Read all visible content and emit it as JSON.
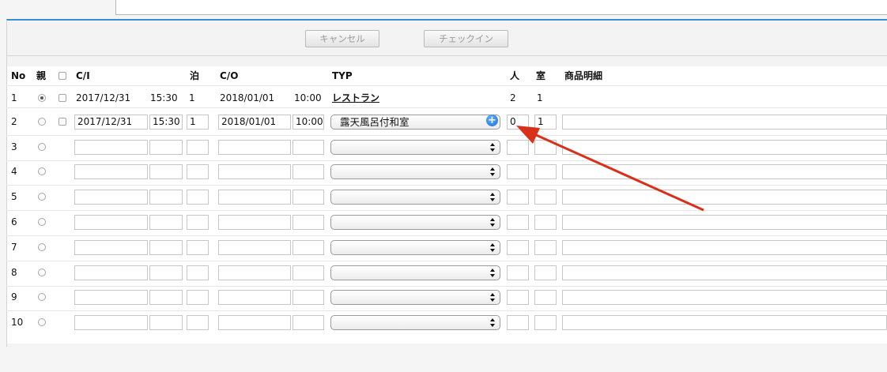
{
  "buttons": {
    "cancel": "キャンセル",
    "checkin": "チェックイン"
  },
  "headers": {
    "no": "No",
    "parent": "親",
    "ci": "C/I",
    "nights": "泊",
    "co": "C/O",
    "typ": "TYP",
    "persons": "人",
    "rooms": "室",
    "details": "商品明細"
  },
  "rows": [
    {
      "no": "1",
      "parent_selected": true,
      "ci_date": "2017/12/31",
      "ci_time": "15:30",
      "nights": "1",
      "co_date": "2018/01/01",
      "co_time": "10:00",
      "typ": "レストラン",
      "persons": "2",
      "rooms": "1",
      "details": ""
    },
    {
      "no": "2",
      "parent_selected": false,
      "ci_date": "2017/12/31",
      "ci_time": "15:30",
      "nights": "1",
      "co_date": "2018/01/01",
      "co_time": "10:00",
      "typ": "露天風呂付和室",
      "persons": "0",
      "rooms": "1",
      "details": ""
    },
    {
      "no": "3",
      "parent_selected": false,
      "ci_date": "",
      "ci_time": "",
      "nights": "",
      "co_date": "",
      "co_time": "",
      "typ": "",
      "persons": "",
      "rooms": "",
      "details": ""
    },
    {
      "no": "4",
      "parent_selected": false,
      "ci_date": "",
      "ci_time": "",
      "nights": "",
      "co_date": "",
      "co_time": "",
      "typ": "",
      "persons": "",
      "rooms": "",
      "details": ""
    },
    {
      "no": "5",
      "parent_selected": false,
      "ci_date": "",
      "ci_time": "",
      "nights": "",
      "co_date": "",
      "co_time": "",
      "typ": "",
      "persons": "",
      "rooms": "",
      "details": ""
    },
    {
      "no": "6",
      "parent_selected": false,
      "ci_date": "",
      "ci_time": "",
      "nights": "",
      "co_date": "",
      "co_time": "",
      "typ": "",
      "persons": "",
      "rooms": "",
      "details": ""
    },
    {
      "no": "7",
      "parent_selected": false,
      "ci_date": "",
      "ci_time": "",
      "nights": "",
      "co_date": "",
      "co_time": "",
      "typ": "",
      "persons": "",
      "rooms": "",
      "details": ""
    },
    {
      "no": "8",
      "parent_selected": false,
      "ci_date": "",
      "ci_time": "",
      "nights": "",
      "co_date": "",
      "co_time": "",
      "typ": "",
      "persons": "",
      "rooms": "",
      "details": ""
    },
    {
      "no": "9",
      "parent_selected": false,
      "ci_date": "",
      "ci_time": "",
      "nights": "",
      "co_date": "",
      "co_time": "",
      "typ": "",
      "persons": "",
      "rooms": "",
      "details": ""
    },
    {
      "no": "10",
      "parent_selected": false,
      "ci_date": "",
      "ci_time": "",
      "nights": "",
      "co_date": "",
      "co_time": "",
      "typ": "",
      "persons": "",
      "rooms": "",
      "details": ""
    }
  ],
  "icons": {
    "add_room": "plus-circle-icon",
    "select_arrows": "updown-chevron-icon",
    "annotation": "red-arrow"
  },
  "colors": {
    "accent": "#3a8fd0",
    "annotation": "#d9301a",
    "plus": "#1a6fd6"
  }
}
